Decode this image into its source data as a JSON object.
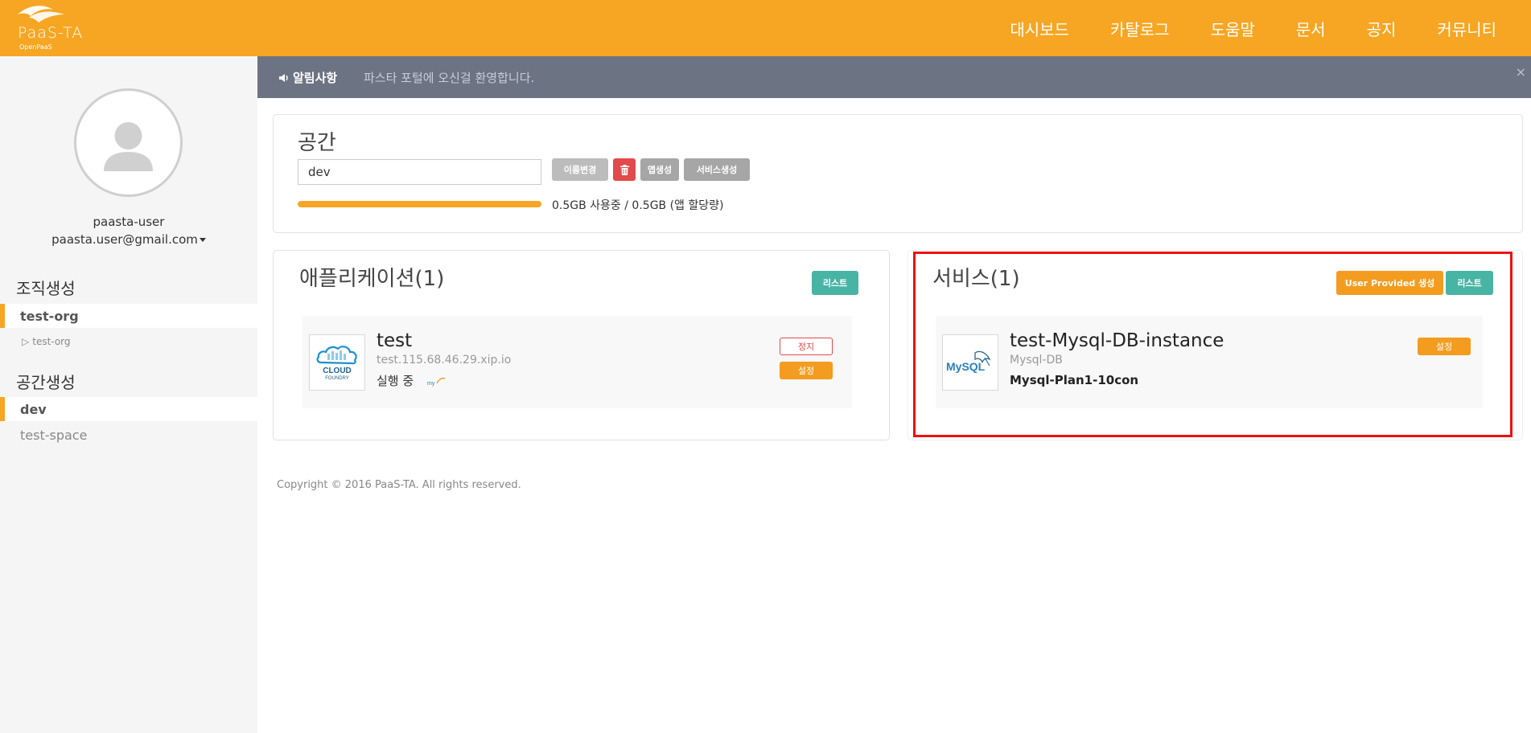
{
  "header": {
    "logo": {
      "brand": "PaaS-TA",
      "sub": "OpenPaaS"
    },
    "nav": [
      "대시보드",
      "카탈로그",
      "도움말",
      "문서",
      "공지",
      "커뮤니티"
    ]
  },
  "sidebar": {
    "user_name": "paasta-user",
    "user_email": "paasta.user@gmail.com",
    "org_section_title": "조직생성",
    "orgs": [
      {
        "label": "test-org",
        "active": true
      },
      {
        "label": "test-org",
        "sub": true
      }
    ],
    "space_section_title": "공간생성",
    "spaces": [
      {
        "label": "dev",
        "active": true
      },
      {
        "label": "test-space"
      }
    ]
  },
  "notice": {
    "label": "알림사항",
    "message": "파스타 포털에 오신걸 환영합니다.",
    "close_icon": "×"
  },
  "space": {
    "title": "공간",
    "name_value": "dev",
    "buttons": {
      "rename": "이름변경",
      "delete_icon": "trash-icon",
      "create_app": "앱생성",
      "create_service": "서비스생성"
    },
    "usage_fraction": 1.0,
    "usage_text": "0.5GB 사용중 / 0.5GB (앱 할당량)"
  },
  "applications": {
    "title": "애플리케이션(1)",
    "list_button": "리스트",
    "items": [
      {
        "name": "test",
        "url": "test.115.68.46.29.xip.io",
        "status": "실행 중",
        "thumbnail": {
          "line1": "CLOUD",
          "line2": "FOUNDRY"
        },
        "stop_button": "정지",
        "settings_button": "설정"
      }
    ]
  },
  "services": {
    "title": "서비스(1)",
    "user_provided_button": "User Provided 생성",
    "list_button": "리스트",
    "items": [
      {
        "name": "test-Mysql-DB-instance",
        "type": "Mysql-DB",
        "plan": "Mysql-Plan1-10con",
        "thumbnail": "MySQL",
        "settings_button": "설정"
      }
    ]
  },
  "footer": {
    "copyright": "Copyright © 2016 PaaS-TA. All rights reserved."
  },
  "colors": {
    "brand_orange": "#f6a623",
    "notice_bg": "#6c7383",
    "teal": "#48b4a4",
    "danger": "#e14b4b",
    "highlight_red": "#ee1111"
  }
}
